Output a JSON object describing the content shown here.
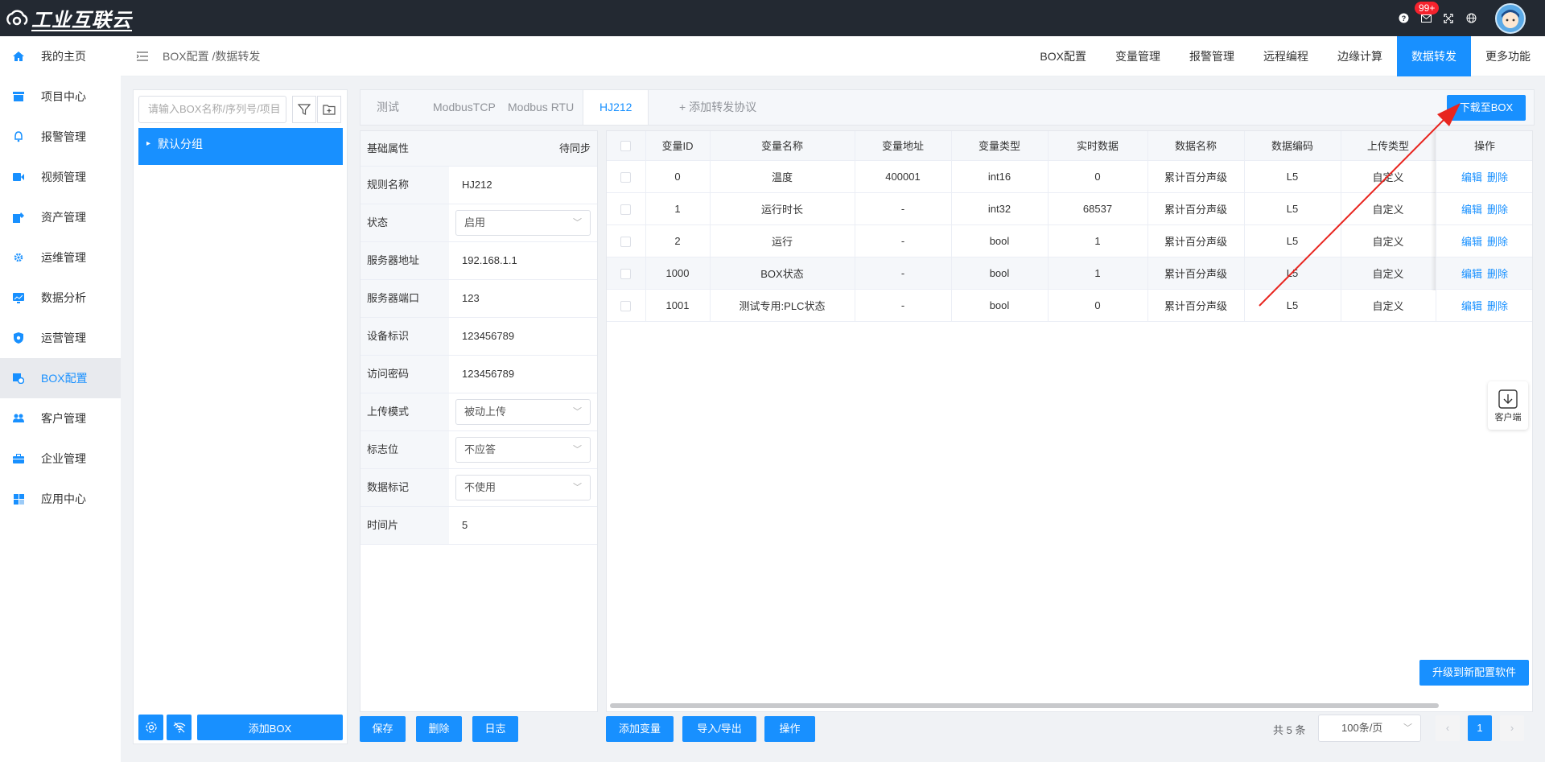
{
  "app": {
    "logo_text": "工业互联云",
    "notifications_badge": "99+"
  },
  "sidebar": {
    "items": [
      {
        "label": "我的主页",
        "icon": "home-icon"
      },
      {
        "label": "项目中心",
        "icon": "project-icon"
      },
      {
        "label": "报警管理",
        "icon": "bell-icon"
      },
      {
        "label": "视频管理",
        "icon": "video-icon"
      },
      {
        "label": "资产管理",
        "icon": "asset-icon"
      },
      {
        "label": "运维管理",
        "icon": "gear-icon"
      },
      {
        "label": "数据分析",
        "icon": "chart-icon"
      },
      {
        "label": "运营管理",
        "icon": "shield-icon"
      },
      {
        "label": "BOX配置",
        "icon": "box-icon",
        "active": true
      },
      {
        "label": "客户管理",
        "icon": "users-icon"
      },
      {
        "label": "企业管理",
        "icon": "briefcase-icon"
      },
      {
        "label": "应用中心",
        "icon": "grid-icon"
      }
    ]
  },
  "breadcrumb": "BOX配置 /数据转发",
  "topnav": [
    {
      "label": "BOX配置"
    },
    {
      "label": "变量管理"
    },
    {
      "label": "报警管理"
    },
    {
      "label": "远程编程"
    },
    {
      "label": "边缘计算"
    },
    {
      "label": "数据转发",
      "active": true
    },
    {
      "label": "更多功能"
    }
  ],
  "left_panel": {
    "search_placeholder": "请输入BOX名称/序列号/项目",
    "group_label": "默认分组",
    "add_box": "添加BOX"
  },
  "tabs": [
    {
      "label": "测试"
    },
    {
      "label": "ModbusTCP"
    },
    {
      "label": "Modbus RTU"
    },
    {
      "label": "HJ212",
      "active": true
    },
    {
      "label": "+ 添加转发协议"
    }
  ],
  "download_button": "下载至BOX",
  "props": {
    "header_label": "基础属性",
    "header_status": "待同步",
    "rows": [
      {
        "label": "规则名称",
        "value": "HJ212",
        "type": "text"
      },
      {
        "label": "状态",
        "value": "启用",
        "type": "select"
      },
      {
        "label": "服务器地址",
        "value": "192.168.1.1",
        "type": "text"
      },
      {
        "label": "服务器端口",
        "value": "123",
        "type": "text"
      },
      {
        "label": "设备标识",
        "value": "123456789",
        "type": "text"
      },
      {
        "label": "访问密码",
        "value": "123456789",
        "type": "text"
      },
      {
        "label": "上传模式",
        "value": "被动上传",
        "type": "select"
      },
      {
        "label": "标志位",
        "value": "不应答",
        "type": "select"
      },
      {
        "label": "数据标记",
        "value": "不使用",
        "type": "select"
      },
      {
        "label": "时间片",
        "value": "5",
        "type": "text"
      }
    ],
    "buttons": {
      "save": "保存",
      "delete": "删除",
      "log": "日志"
    }
  },
  "table": {
    "headers": [
      "变量ID",
      "变量名称",
      "变量地址",
      "变量类型",
      "实时数据",
      "数据名称",
      "数据编码",
      "上传类型",
      "操作"
    ],
    "rows": [
      [
        "0",
        "温度",
        "400001",
        "int16",
        "0",
        "累计百分声级",
        "L5",
        "自定义"
      ],
      [
        "1",
        "运行时长",
        "-",
        "int32",
        "68537",
        "累计百分声级",
        "L5",
        "自定义"
      ],
      [
        "2",
        "运行",
        "-",
        "bool",
        "1",
        "累计百分声级",
        "L5",
        "自定义"
      ],
      [
        "1000",
        "BOX状态",
        "-",
        "bool",
        "1",
        "累计百分声级",
        "L5",
        "自定义"
      ],
      [
        "1001",
        "测试专用:PLC状态",
        "-",
        "bool",
        "0",
        "累计百分声级",
        "L5",
        "自定义"
      ]
    ],
    "edit_label": "编辑",
    "delete_label": "删除"
  },
  "table_buttons": {
    "add_var": "添加变量",
    "import_export": "导入/导出",
    "operate": "操作"
  },
  "upgrade_button": "升级到新配置软件",
  "client_label": "客户端",
  "pager": {
    "total": "共 5 条",
    "page_size": "100条/页",
    "current_page": "1"
  },
  "colors": {
    "primary": "#1890ff",
    "topbar": "#232932",
    "annotation": "#e8251f"
  }
}
